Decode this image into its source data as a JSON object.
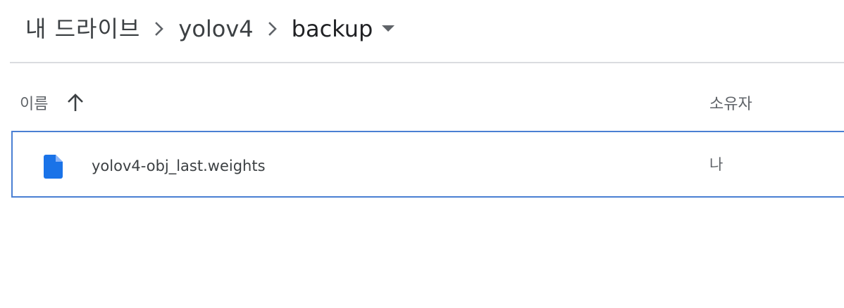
{
  "breadcrumb": {
    "root": "내 드라이브",
    "folder": "yolov4",
    "current": "backup",
    "separator_icon": "chevron-right-icon",
    "dropdown_icon": "caret-down-icon"
  },
  "columns": {
    "name": "이름",
    "name_sort_icon": "arrow-up-icon",
    "owner": "소유자"
  },
  "files": [
    {
      "name": "yolov4-obj_last.weights",
      "owner": "나",
      "icon": "file-icon",
      "icon_color": "#1a73e8",
      "selected": true
    }
  ],
  "colors": {
    "selection_border": "#4a7fd3",
    "divider": "#dadce0",
    "muted_text": "#5f6368"
  }
}
